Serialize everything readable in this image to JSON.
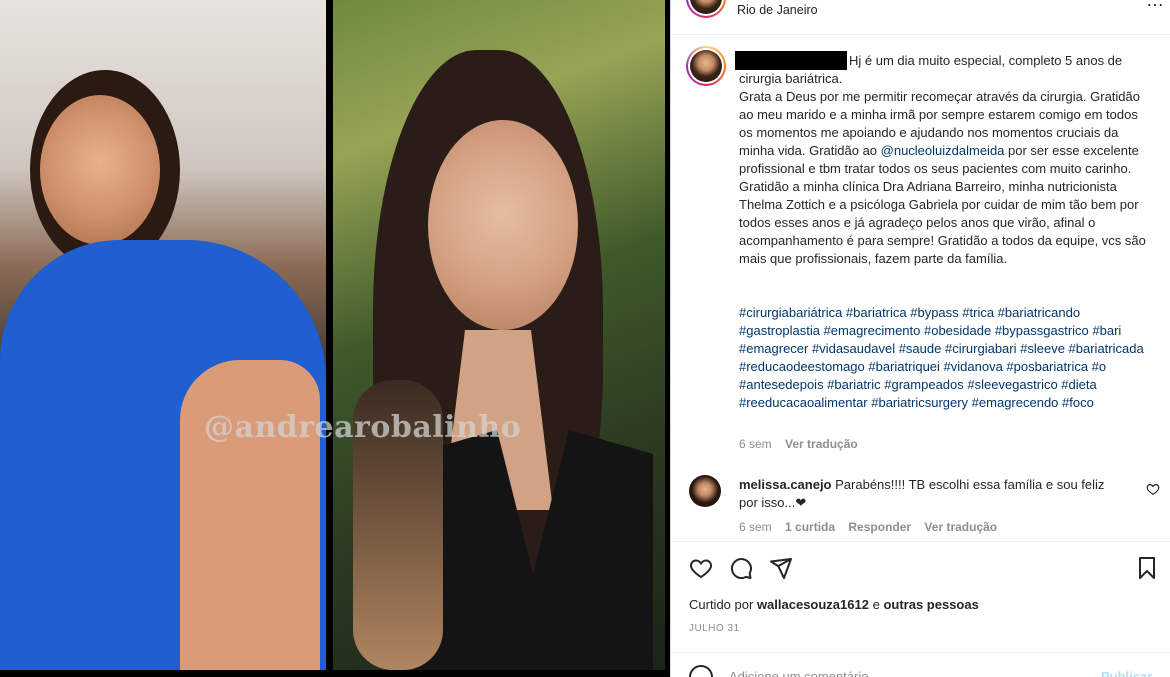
{
  "header": {
    "location": "Rio de Janeiro",
    "more_icon": "more-horizontal-icon"
  },
  "caption": {
    "text_first": "Hj é um dia muito especial, completo 5 anos de cirurgia bariátrica.",
    "text_rest": "Grata a Deus por me permitir recomeçar através da cirurgia. Gratidão ao meu marido e a minha irmã por sempre estarem comigo em todos os momentos me apoiando e ajudando nos momentos cruciais da minha vida. Gratidão ao ",
    "mention": "@nucleoluizdalmeida",
    "text_end": " por ser esse excelente profissional e tbm tratar todos os seus pacientes com muito carinho. Gratidão a minha clínica Dra Adriana Barreiro, minha nutricionista Thelma Zottich e a psicóloga Gabriela por cuidar de mim tão bem por todos esses anos e já agradeço pelos anos que virão, afinal o acompanhamento é para sempre! Gratidão a todos da equipe, vcs são mais que profissionais, fazem parte da família.",
    "hashtags": "#cirurgiabariátrica #bariatrica #bypass #trica #bariatricando #gastroplastia #emagrecimento #obesidade #bypassgastrico #bari #emagrecer #vidasaudavel #saude #cirurgiabari #sleeve #bariatricada #reducaodeestomago #bariatriquei #vidanova #posbariatrica #o #antesedepois #bariatric #grampeados #sleevegastrico #dieta #reeducacaoalimentar #bariatricsurgery #emagrecendo #foco",
    "time": "6 sem",
    "see_translation": "Ver tradução"
  },
  "photo": {
    "watermark": "@andrearobalinho"
  },
  "comment": {
    "username": "melissa.canejo",
    "text": "Parabéns!!!! TB escolhi essa família e sou feliz por isso...❤",
    "time": "6 sem",
    "likes": "1 curtida",
    "reply": "Responder",
    "see_translation": "Ver tradução"
  },
  "actions": {
    "like_icon": "heart-icon",
    "comment_icon": "comment-icon",
    "share_icon": "paper-plane-icon",
    "save_icon": "bookmark-icon"
  },
  "likes": {
    "prefix": "Curtido por",
    "user": "wallacesouza1612",
    "conj": "e",
    "others": "outras pessoas"
  },
  "date": "JULHO 31",
  "comment_box": {
    "placeholder": "Adicione um comentário...",
    "publish": "Publicar"
  },
  "colors": {
    "link": "#00376b",
    "muted": "#8e8e8e",
    "text": "#262626",
    "publish": "#b2dffc"
  }
}
